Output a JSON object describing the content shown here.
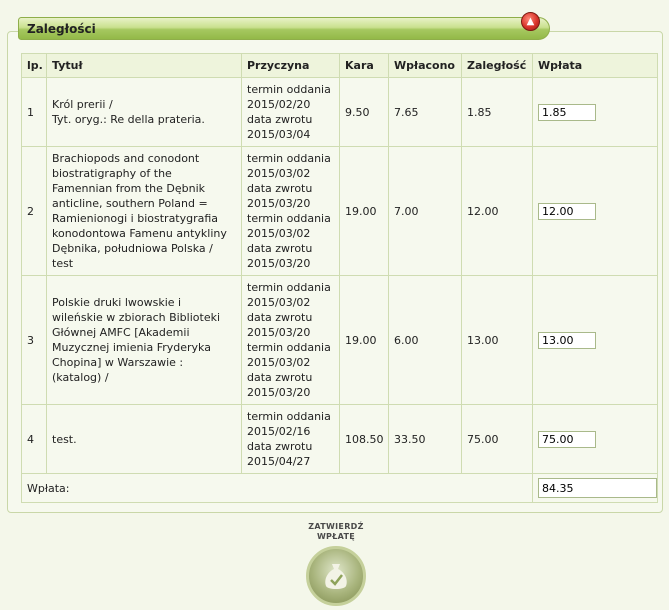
{
  "panel": {
    "title": "Zaległości"
  },
  "table": {
    "headers": [
      "lp.",
      "Tytuł",
      "Przyczyna",
      "Kara",
      "Wpłacono",
      "Zaległość",
      "Wpłata"
    ],
    "rows": [
      {
        "lp": "1",
        "title_lines": [
          "Król prerii /",
          "Tyt. oryg.: Re della prateria."
        ],
        "reason_lines": [
          "termin oddania",
          "2015/02/20",
          "data zwrotu",
          "2015/03/04"
        ],
        "kara": "9.50",
        "wplacono": "7.65",
        "zaleglosc": "1.85",
        "wplata": "1.85"
      },
      {
        "lp": "2",
        "title_lines": [
          "Brachiopods and conodont",
          "biostratigraphy of the",
          "Famennian from the Dębnik",
          "anticline, southern Poland =",
          "Ramienionogi i biostratygrafia",
          "konodontowa Famenu antykliny",
          "Dębnika, południowa Polska /",
          "test"
        ],
        "reason_lines": [
          "termin oddania",
          "2015/03/02",
          "data zwrotu",
          "2015/03/20",
          "termin oddania",
          "2015/03/02",
          "data zwrotu",
          "2015/03/20"
        ],
        "kara": "19.00",
        "wplacono": "7.00",
        "zaleglosc": "12.00",
        "wplata": "12.00"
      },
      {
        "lp": "3",
        "title_lines": [
          "Polskie druki lwowskie i",
          "wileńskie w zbiorach Biblioteki",
          "Głównej AMFC [Akademii",
          "Muzycznej imienia Fryderyka",
          "Chopina] w Warszawie :",
          "(katalog) /"
        ],
        "reason_lines": [
          "termin oddania",
          "2015/03/02",
          "data zwrotu",
          "2015/03/20",
          "termin oddania",
          "2015/03/02",
          "data zwrotu",
          "2015/03/20"
        ],
        "kara": "19.00",
        "wplacono": "6.00",
        "zaleglosc": "13.00",
        "wplata": "13.00"
      },
      {
        "lp": "4",
        "title_lines": [
          "test."
        ],
        "reason_lines": [
          "termin oddania",
          "2015/02/16",
          "data zwrotu",
          "2015/04/27"
        ],
        "kara": "108.50",
        "wplacono": "33.50",
        "zaleglosc": "75.00",
        "wplata": "75.00"
      }
    ],
    "sum_label": "Wpłata:",
    "sum_value": "84.35"
  },
  "confirm": {
    "line1": "ZATWIERDŹ",
    "line2": "WPŁATĘ",
    "icon": "money-bag-check-icon"
  },
  "colors": {
    "accent": "#9cc155",
    "border": "#cfdcb2",
    "background": "#f4f7ea"
  }
}
